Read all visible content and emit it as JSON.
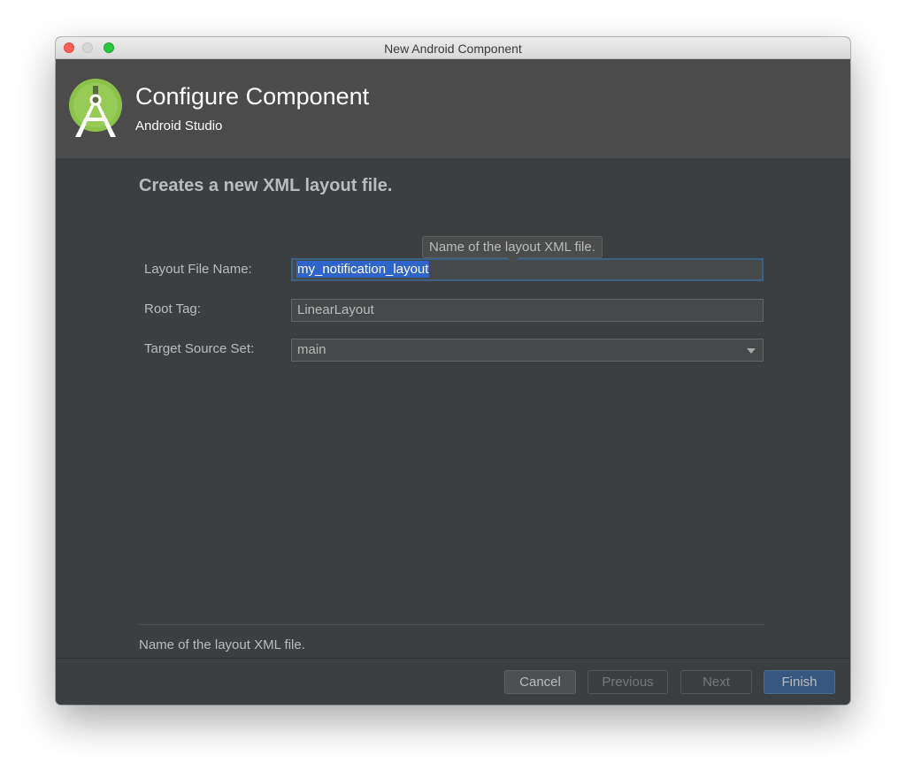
{
  "window": {
    "title": "New Android Component"
  },
  "header": {
    "title": "Configure Component",
    "subtitle": "Android Studio",
    "logo_icon": "android-studio-logo-icon"
  },
  "form": {
    "section_title": "Creates a new XML layout file.",
    "fields": [
      {
        "label": "Layout File Name:",
        "value": "my_notification_layout",
        "state": "focused-selected"
      },
      {
        "label": "Root Tag:",
        "value": "LinearLayout"
      },
      {
        "label": "Target Source Set:",
        "value": "main",
        "type": "dropdown"
      }
    ],
    "tooltip": "Name of the layout XML file.",
    "help_text": "Name of the layout XML file."
  },
  "buttons": {
    "cancel": "Cancel",
    "previous": "Previous",
    "next": "Next",
    "finish": "Finish"
  },
  "colors": {
    "dialog_background": "#3c3f41",
    "header_background": "#4b4b4b",
    "text_selection": "#2f65ca",
    "default_button": "#365880",
    "logo_green": "#8bc34a"
  }
}
